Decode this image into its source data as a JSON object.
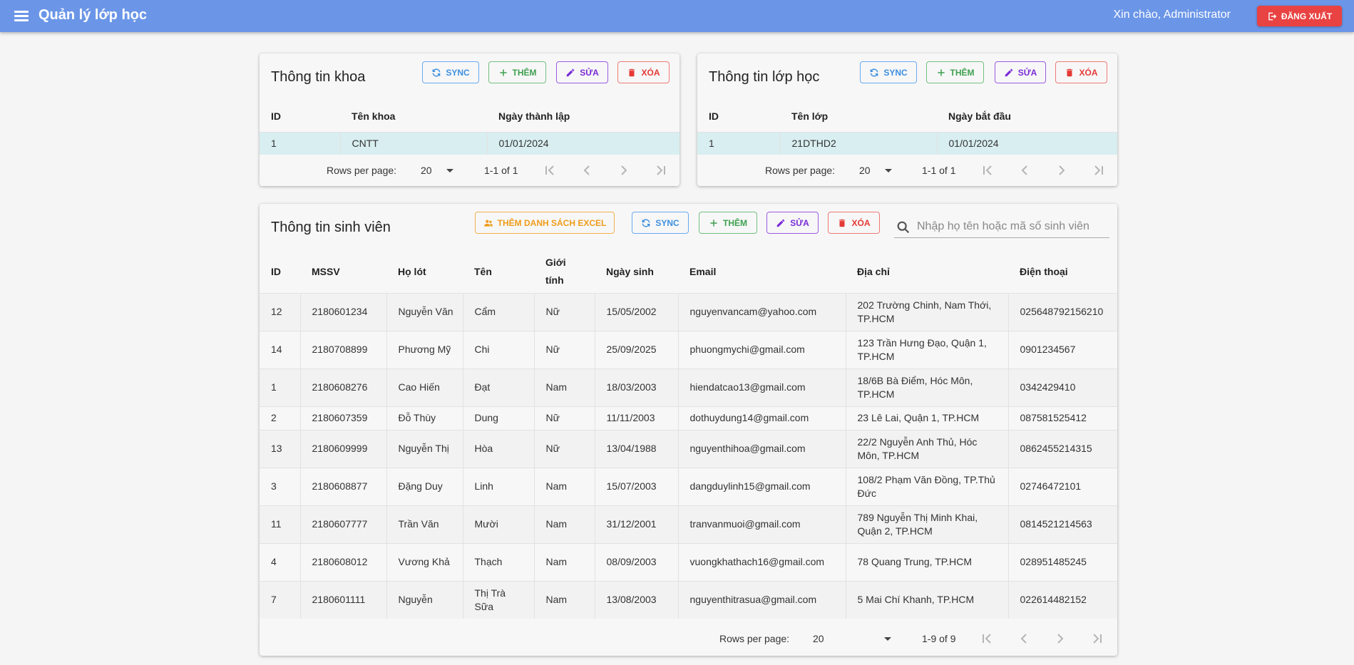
{
  "appbar": {
    "title": "Quản lý lớp học",
    "greeting": "Xin chào, Administrator",
    "logout_label": "ĐĂNG XUẤT"
  },
  "buttons": {
    "sync": "SYNC",
    "add": "THÊM",
    "edit": "SỬA",
    "delete": "XÓA",
    "add_excel": "THÊM DANH SÁCH EXCEL"
  },
  "faculty": {
    "title": "Thông tin khoa",
    "columns": [
      "ID",
      "Tên khoa",
      "Ngày thành lập"
    ],
    "rows": [
      [
        "1",
        "CNTT",
        "01/01/2024"
      ]
    ],
    "rows_per_page_label": "Rows per page:",
    "rows_per_page": "20",
    "range": "1-1 of 1"
  },
  "classes": {
    "title": "Thông tin lớp học",
    "columns": [
      "ID",
      "Tên lớp",
      "Ngày bắt đầu"
    ],
    "rows": [
      [
        "1",
        "21DTHD2",
        "01/01/2024"
      ]
    ],
    "rows_per_page_label": "Rows per page:",
    "rows_per_page": "20",
    "range": "1-1 of 1"
  },
  "students": {
    "title": "Thông tin sinh viên",
    "search_placeholder": "Nhập họ tên hoặc mã số sinh viên",
    "columns": [
      "ID",
      "MSSV",
      "Họ lót",
      "Tên",
      "Giới tính",
      "Ngày sinh",
      "Email",
      "Địa chỉ",
      "Điện thoại"
    ],
    "rows": [
      [
        "12",
        "2180601234",
        "Nguyễn Văn",
        "Cẩm",
        "Nữ",
        "15/05/2002",
        "nguyenvancam@yahoo.com",
        "202 Trường Chinh, Nam Thới, TP.HCM",
        "025648792156210"
      ],
      [
        "14",
        "2180708899",
        "Phương Mỹ",
        "Chi",
        "Nữ",
        "25/09/2025",
        "phuongmychi@gmail.com",
        "123 Trần Hưng Đạo, Quận 1, TP.HCM",
        "0901234567"
      ],
      [
        "1",
        "2180608276",
        "Cao Hiến",
        "Đạt",
        "Nam",
        "18/03/2003",
        "hiendatcao13@gmail.com",
        "18/6B Bà Điểm, Hóc Môn, TP.HCM",
        "0342429410"
      ],
      [
        "2",
        "2180607359",
        "Đỗ Thùy",
        "Dung",
        "Nữ",
        "11/11/2003",
        "dothuydung14@gmail.com",
        "23 Lê Lai, Quận 1, TP.HCM",
        "087581525412"
      ],
      [
        "13",
        "2180609999",
        "Nguyễn Thị",
        "Hòa",
        "Nữ",
        "13/04/1988",
        "nguyenthihoa@gmail.com",
        "22/2 Nguyễn Anh Thủ, Hóc Môn, TP.HCM",
        "0862455214315"
      ],
      [
        "3",
        "2180608877",
        "Đặng Duy",
        "Linh",
        "Nam",
        "15/07/2003",
        "dangduylinh15@gmail.com",
        "108/2 Phạm Văn Đồng, TP.Thủ Đức",
        "02746472101"
      ],
      [
        "11",
        "2180607777",
        "Trần Văn",
        "Mười",
        "Nam",
        "31/12/2001",
        "tranvanmuoi@gmail.com",
        "789 Nguyễn Thị Minh Khai, Quận 2, TP.HCM",
        "0814521214563"
      ],
      [
        "4",
        "2180608012",
        "Vương Khả",
        "Thạch",
        "Nam",
        "08/09/2003",
        "vuongkhathach16@gmail.com",
        "78 Quang Trung, TP.HCM",
        "028951485245"
      ],
      [
        "7",
        "2180601111",
        "Nguyễn",
        "Thị Trà Sữa",
        "Nam",
        "13/08/2003",
        "nguyenthitrasua@gmail.com",
        "5 Mai Chí Khanh, TP.HCM",
        "022614482152"
      ]
    ],
    "rows_per_page_label": "Rows per page:",
    "rows_per_page": "20",
    "range": "1-9 of 9"
  },
  "colors": {
    "appbar": "#6b96e8",
    "logout": "#e94242",
    "sync": "#3d8fe0",
    "add": "#3fa050",
    "edit": "#7a2bd6",
    "delete": "#e53935",
    "excel": "#ef9c1b",
    "selected_row": "#d8eef0"
  },
  "icons": [
    "menu-icon",
    "logout-icon",
    "sync-icon",
    "plus-icon",
    "pencil-icon",
    "trash-icon",
    "group-icon",
    "search-icon",
    "dropdown-caret-icon",
    "first-page-icon",
    "prev-page-icon",
    "next-page-icon",
    "last-page-icon"
  ]
}
